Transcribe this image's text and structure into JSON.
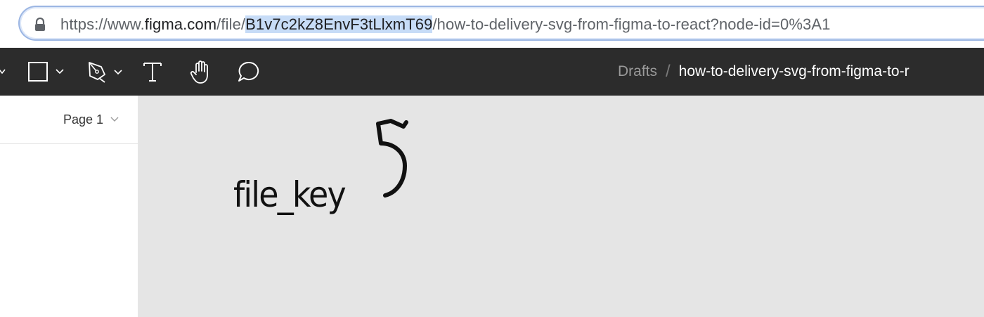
{
  "browser": {
    "url_prefix": "https://www.",
    "url_host": "figma.com",
    "url_path_start": "/file/",
    "url_file_key": "B1v7c2kZ8EnvF3tLlxmT69",
    "url_rest": "/how-to-delivery-svg-from-figma-to-react?node-id=0%3A1",
    "lock_icon": "lock-icon"
  },
  "toolbar": {
    "tools": [
      {
        "name": "menu-chevron-icon"
      },
      {
        "name": "frame-rectangle-icon"
      },
      {
        "name": "pen-icon"
      },
      {
        "name": "text-icon"
      },
      {
        "name": "hand-icon"
      },
      {
        "name": "comment-icon"
      }
    ],
    "breadcrumb_parent": "Drafts",
    "breadcrumb_separator": "/",
    "breadcrumb_file": "how-to-delivery-svg-from-figma-to-r"
  },
  "left_panel": {
    "page_label": "Page 1"
  },
  "canvas": {
    "annotation_label": "file_key",
    "background": "#e5e5e5"
  },
  "colors": {
    "toolbar_bg": "#2c2c2c",
    "highlight": "#c7dcf7",
    "url_focus_border": "#9cb6e3"
  }
}
